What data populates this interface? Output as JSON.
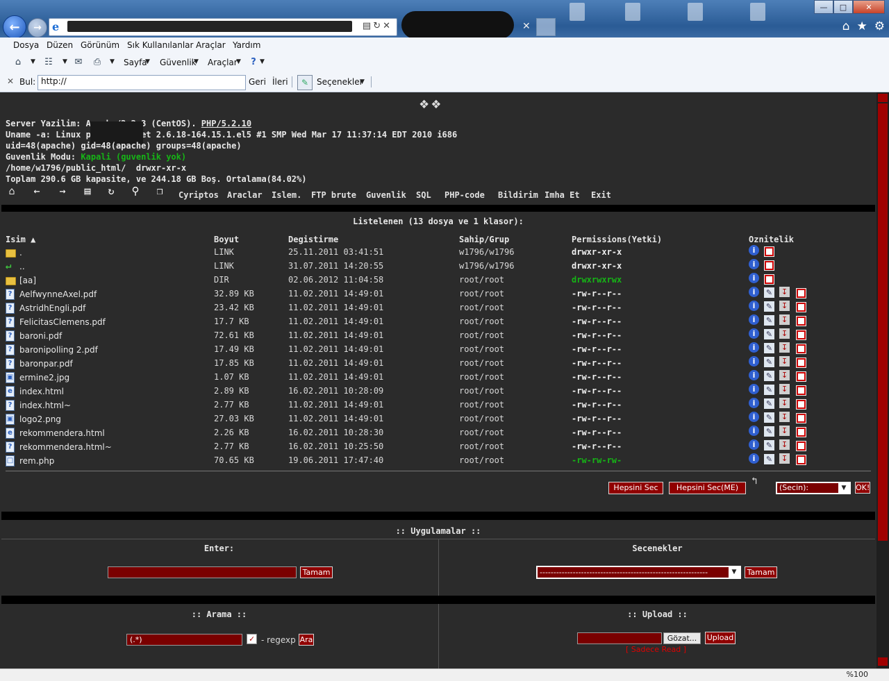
{
  "browser": {
    "menu": [
      "Dosya",
      "Düzen",
      "Görünüm",
      "Sık Kullanılanlar",
      "Araçlar",
      "Yardım"
    ],
    "toolbar": {
      "page": "Sayfa",
      "security": "Güvenlik",
      "tools": "Araçlar"
    },
    "find": {
      "label": "Bul:",
      "value": "http://",
      "back": "Geri",
      "forward": "İleri",
      "options": "Seçenekler"
    },
    "zoom": "%100"
  },
  "server": {
    "software_label": "Server Yazilim:",
    "software_value": "Apache/2.2.3 (CentOS).",
    "php": "PHP/5.2.10",
    "uname": "Uname -a: Linux php5.3rex.net 2.6.18-164.15.1.el5 #1 SMP Wed Mar 17 11:37:14 EDT 2010 i686",
    "uid": "uid=48(apache) gid=48(apache) groups=48(apache)",
    "safe_mode_label": "Guvenlik Modu:",
    "safe_mode_value": "Kapali (guvenlik yok)",
    "path": "/home/w1796/public_html/",
    "path_perm": "drwxr-xr-x",
    "disk": "Toplam 290.6 GB kapasite, ve 244.18 GB Boş. Ortalama(84.02%)"
  },
  "nav_icons": [
    "home-icon",
    "back-icon",
    "forward-icon",
    "folder-up-icon",
    "refresh-icon",
    "search-icon",
    "copy-icon"
  ],
  "menu_links": [
    "Cyriptos",
    "Araclar",
    "Islem.",
    "FTP brute",
    "Guvenlik",
    "SQL",
    "PHP-code",
    "Bildirim",
    "Imha Et",
    "Exit"
  ],
  "listing": {
    "title": "Listelenen (13 dosya ve 1 klasor):",
    "columns": {
      "name": "Isim ▲",
      "size": "Boyut",
      "modified": "Degistirme",
      "owner": "Sahip/Grup",
      "perms": "Permissions(Yetki)",
      "attrs": "Oznitelik"
    },
    "rows": [
      {
        "icon": "folder",
        "name": ".",
        "size": "LINK",
        "date": "25.11.2011 03:41:51",
        "owner": "w1796/w1796",
        "perm": "drwxr-xr-x",
        "green": false,
        "dir": true
      },
      {
        "icon": "up",
        "name": "..",
        "size": "LINK",
        "date": "31.07.2011 14:20:55",
        "owner": "w1796/w1796",
        "perm": "drwxr-xr-x",
        "green": false,
        "dir": true
      },
      {
        "icon": "folder",
        "name": "[aa]",
        "size": "DIR",
        "date": "02.06.2012 11:04:58",
        "owner": "root/root",
        "perm": "drwxrwxrwx",
        "green": true,
        "dir": true
      },
      {
        "icon": "doc",
        "name": "AelfwynneAxel.pdf",
        "size": "32.89 KB",
        "date": "11.02.2011 14:49:01",
        "owner": "root/root",
        "perm": "-rw-r--r--",
        "green": false,
        "dir": false
      },
      {
        "icon": "doc",
        "name": "AstridhEngli.pdf",
        "size": "23.42 KB",
        "date": "11.02.2011 14:49:01",
        "owner": "root/root",
        "perm": "-rw-r--r--",
        "green": false,
        "dir": false
      },
      {
        "icon": "doc",
        "name": "FelicitasClemens.pdf",
        "size": "17.7 KB",
        "date": "11.02.2011 14:49:01",
        "owner": "root/root",
        "perm": "-rw-r--r--",
        "green": false,
        "dir": false
      },
      {
        "icon": "doc",
        "name": "baroni.pdf",
        "size": "72.61 KB",
        "date": "11.02.2011 14:49:01",
        "owner": "root/root",
        "perm": "-rw-r--r--",
        "green": false,
        "dir": false
      },
      {
        "icon": "doc",
        "name": "baronipolling 2.pdf",
        "size": "17.49 KB",
        "date": "11.02.2011 14:49:01",
        "owner": "root/root",
        "perm": "-rw-r--r--",
        "green": false,
        "dir": false
      },
      {
        "icon": "doc",
        "name": "baronpar.pdf",
        "size": "17.85 KB",
        "date": "11.02.2011 14:49:01",
        "owner": "root/root",
        "perm": "-rw-r--r--",
        "green": false,
        "dir": false
      },
      {
        "icon": "img",
        "name": "ermine2.jpg",
        "size": "1.07 KB",
        "date": "11.02.2011 14:49:01",
        "owner": "root/root",
        "perm": "-rw-r--r--",
        "green": false,
        "dir": false
      },
      {
        "icon": "html",
        "name": "index.html",
        "size": "2.89 KB",
        "date": "16.02.2011 10:28:09",
        "owner": "root/root",
        "perm": "-rw-r--r--",
        "green": false,
        "dir": false
      },
      {
        "icon": "doc",
        "name": "index.html~",
        "size": "2.77 KB",
        "date": "11.02.2011 14:49:01",
        "owner": "root/root",
        "perm": "-rw-r--r--",
        "green": false,
        "dir": false
      },
      {
        "icon": "img",
        "name": "logo2.png",
        "size": "27.03 KB",
        "date": "11.02.2011 14:49:01",
        "owner": "root/root",
        "perm": "-rw-r--r--",
        "green": false,
        "dir": false
      },
      {
        "icon": "html",
        "name": "rekommendera.html",
        "size": "2.26 KB",
        "date": "16.02.2011 10:28:30",
        "owner": "root/root",
        "perm": "-rw-r--r--",
        "green": false,
        "dir": false
      },
      {
        "icon": "doc",
        "name": "rekommendera.html~",
        "size": "2.77 KB",
        "date": "16.02.2011 10:25:50",
        "owner": "root/root",
        "perm": "-rw-r--r--",
        "green": false,
        "dir": false
      },
      {
        "icon": "php",
        "name": "rem.php",
        "size": "70.65 KB",
        "date": "19.06.2011 17:47:40",
        "owner": "root/root",
        "perm": "-rw-rw-rw-",
        "green": true,
        "dir": false
      }
    ],
    "select_all": "Hepsini Sec",
    "select_me": "Hepsini Sec(ME)",
    "action_select": "(Secin):",
    "ok": "OK!"
  },
  "apps": {
    "title": ":: Uygulamalar ::",
    "enter_label": "Enter:",
    "enter_btn": "Tamam",
    "options_label": "Secenekler",
    "options_value": "-------------------------------------------------------------",
    "options_btn": "Tamam"
  },
  "search": {
    "title": ":: Arama ::",
    "value": "(.*)",
    "regexp": "- regexp",
    "btn": "Ara"
  },
  "upload": {
    "title": ":: Upload ::",
    "browse": "Gözat...",
    "btn": "Upload",
    "readonly": "[ Sadece Read ]"
  },
  "colors": {
    "bg": "#2b2b2b",
    "accent": "#900000",
    "green": "#16b516"
  }
}
